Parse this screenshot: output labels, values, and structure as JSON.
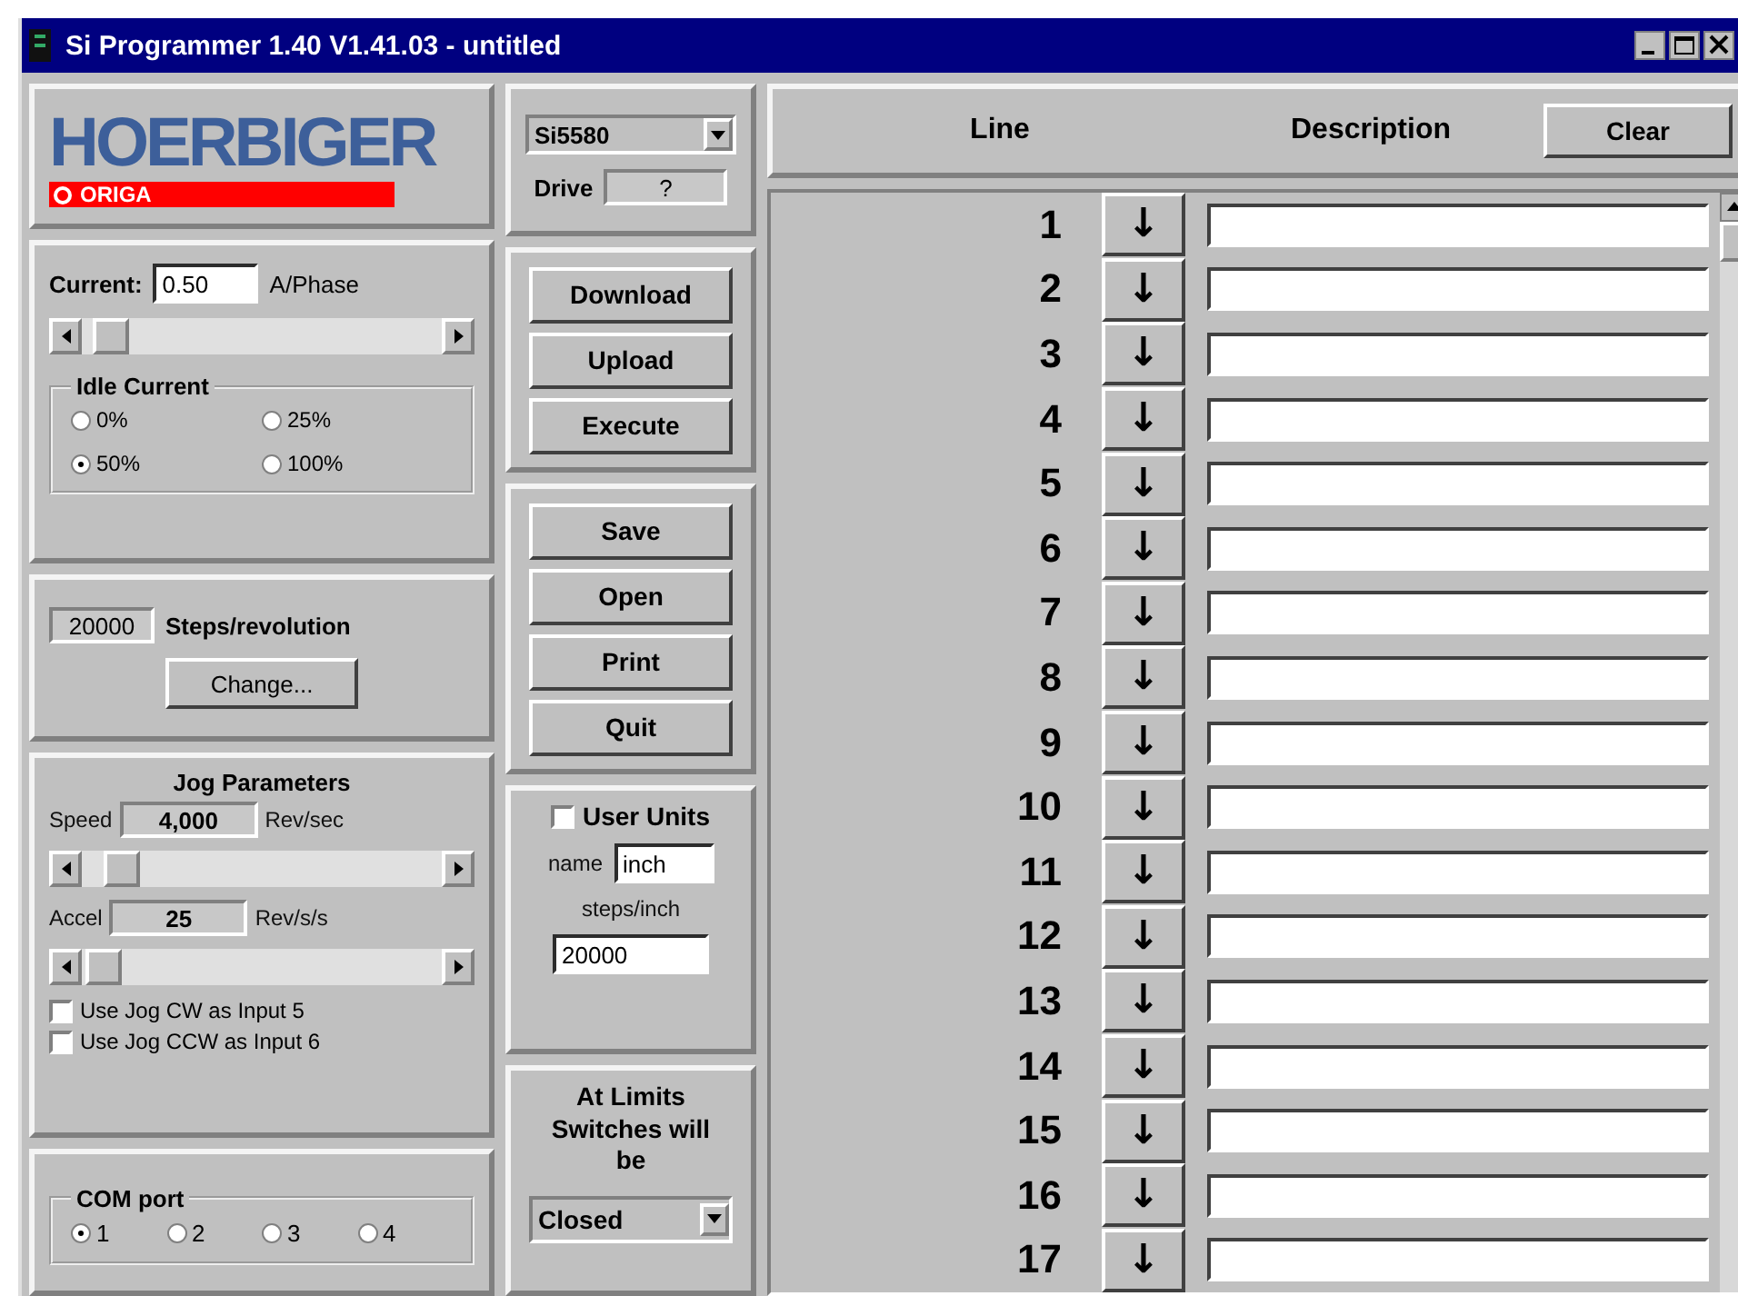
{
  "window": {
    "title": "Si Programmer 1.40  V1.41.03 - untitled"
  },
  "logo": {
    "brand": "HOERBIGER",
    "sub": "ORIGA"
  },
  "drive": {
    "model": "Si5580",
    "label": "Drive",
    "value": "?"
  },
  "current": {
    "label": "Current:",
    "value": "0.50",
    "unit": "A/Phase",
    "level": 0.03
  },
  "idle_current": {
    "title": "Idle Current",
    "options": [
      {
        "label": "0%",
        "selected": false
      },
      {
        "label": "25%",
        "selected": false
      },
      {
        "label": "50%",
        "selected": true
      },
      {
        "label": "100%",
        "selected": false
      }
    ]
  },
  "steps": {
    "value": "20000",
    "label": "Steps/revolution",
    "button": "Change..."
  },
  "jog": {
    "title": "Jog Parameters",
    "params": [
      {
        "label": "Speed",
        "value": "4,000",
        "unit": "Rev/sec",
        "level": 0.06
      },
      {
        "label": "Accel",
        "value": "25",
        "unit": "Rev/s/s",
        "level": 0.01
      }
    ],
    "checkboxes": [
      {
        "label": "Use Jog CW as Input 5",
        "checked": false
      },
      {
        "label": "Use Jog CCW as Input 6",
        "checked": false
      }
    ]
  },
  "com_port": {
    "title": "COM port",
    "options": [
      {
        "label": "1",
        "selected": true
      },
      {
        "label": "2",
        "selected": false
      },
      {
        "label": "3",
        "selected": false
      },
      {
        "label": "4",
        "selected": false
      }
    ]
  },
  "buttons_top": [
    "Download",
    "Upload",
    "Execute"
  ],
  "buttons_file": [
    "Save",
    "Open",
    "Print",
    "Quit"
  ],
  "user_units": {
    "label": "User Units",
    "checked": false,
    "name_label": "name",
    "name_value": "inch",
    "steps_label": "steps/inch",
    "steps_value": "20000"
  },
  "limits": {
    "label": "At Limits Switches will be",
    "value": "Closed"
  },
  "program": {
    "columns": [
      "Line",
      "Description"
    ],
    "clear": "Clear",
    "rows": [
      {
        "line": "1",
        "arrow": "↓"
      },
      {
        "line": "2",
        "arrow": "↓"
      },
      {
        "line": "3",
        "arrow": "↓"
      },
      {
        "line": "4",
        "arrow": "↓"
      },
      {
        "line": "5",
        "arrow": "↓"
      },
      {
        "line": "6",
        "arrow": "↓"
      },
      {
        "line": "7",
        "arrow": "↓"
      },
      {
        "line": "8",
        "arrow": "↓"
      },
      {
        "line": "9",
        "arrow": "↓"
      },
      {
        "line": "10",
        "arrow": "↓"
      },
      {
        "line": "11",
        "arrow": "↓"
      },
      {
        "line": "12",
        "arrow": "↓"
      },
      {
        "line": "13",
        "arrow": "↓"
      },
      {
        "line": "14",
        "arrow": "↓"
      },
      {
        "line": "15",
        "arrow": "↓"
      },
      {
        "line": "16",
        "arrow": "↓"
      },
      {
        "line": "17",
        "arrow": "↓"
      }
    ]
  }
}
